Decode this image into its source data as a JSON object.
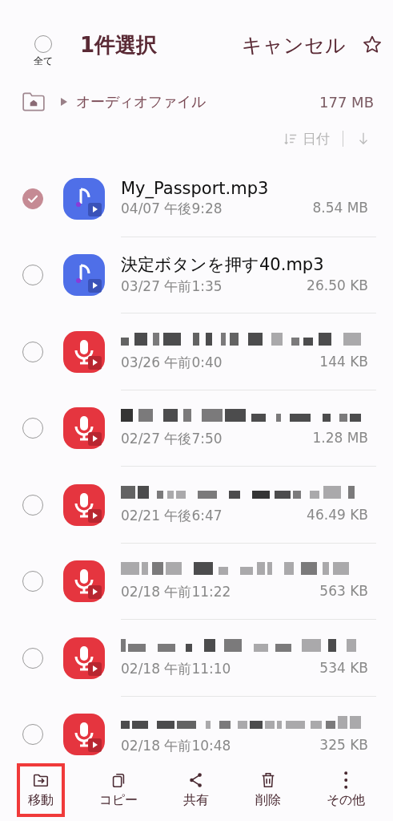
{
  "header": {
    "select_all": {
      "label": "全て",
      "checked": false
    },
    "title": "1件選択",
    "cancel": "キャンセル",
    "favorite": false
  },
  "breadcrumb": {
    "path": "オーディオファイル",
    "size": "177 MB"
  },
  "sort": {
    "field": "日付"
  },
  "files": [
    {
      "kind": "music",
      "name": "My_Passport.mp3",
      "date": "04/07 午後9:28",
      "size": "8.54 MB",
      "selected": true
    },
    {
      "kind": "music",
      "name": "決定ボタンを押す40.mp3",
      "date": "03/27 午前1:35",
      "size": "26.50 KB",
      "selected": false
    },
    {
      "kind": "voice",
      "date": "03/26 午前0:40",
      "size": "144 KB",
      "selected": false
    },
    {
      "kind": "voice",
      "date": "02/27 午後7:50",
      "size": "1.28 MB",
      "selected": false
    },
    {
      "kind": "voice",
      "date": "02/21 午後6:47",
      "size": "46.49 KB",
      "selected": false
    },
    {
      "kind": "voice",
      "date": "02/18 午前11:22",
      "size": "563 KB",
      "selected": false
    },
    {
      "kind": "voice",
      "date": "02/18 午前11:10",
      "size": "534 KB",
      "selected": false
    },
    {
      "kind": "voice",
      "date": "02/18 午前10:48",
      "size": "325 KB",
      "selected": false
    }
  ],
  "toolbar": [
    {
      "kind": "move",
      "label": "移動",
      "highlighted": true
    },
    {
      "kind": "copy",
      "label": "コピー",
      "highlighted": false
    },
    {
      "kind": "share",
      "label": "共有",
      "highlighted": false
    },
    {
      "kind": "delete",
      "label": "削除",
      "highlighted": false
    },
    {
      "kind": "more",
      "label": "その他",
      "highlighted": false
    }
  ]
}
